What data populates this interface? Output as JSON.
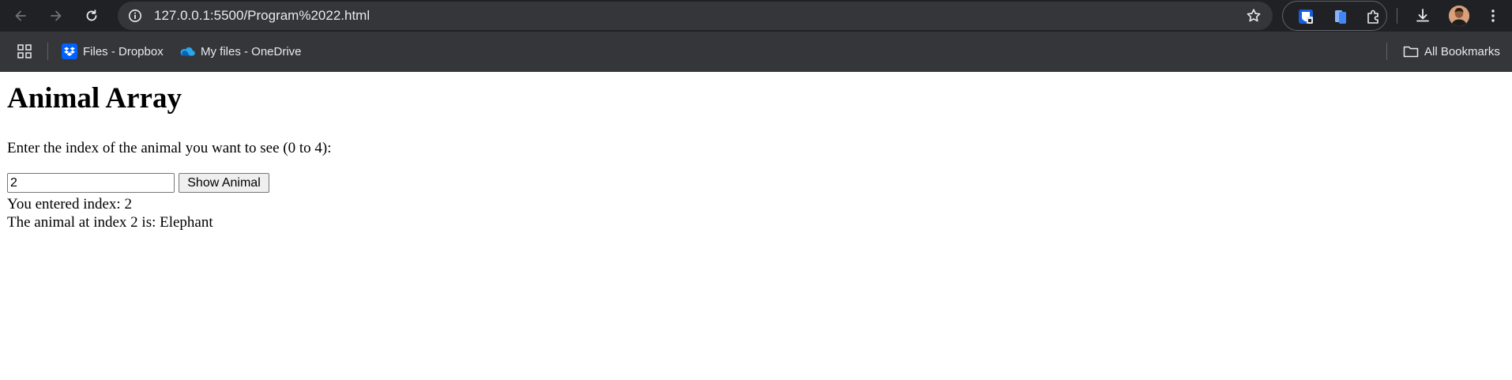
{
  "browser": {
    "url": "127.0.0.1:5500/Program%2022.html",
    "bookmarks": [
      {
        "label": "Files - Dropbox",
        "icon": "dropbox-icon"
      },
      {
        "label": "My files - OneDrive",
        "icon": "onedrive-icon"
      }
    ],
    "all_bookmarks_label": "All Bookmarks",
    "colors": {
      "toolbar_bg": "#202124",
      "omnibox_bg": "#35363a",
      "text": "#e8eaed",
      "dropbox_blue": "#0061fe",
      "onedrive_blue": "#28a8ea"
    }
  },
  "page": {
    "title": "Animal Array",
    "prompt": "Enter the index of the animal you want to see (0 to 4):",
    "input_value": "2",
    "button_label": "Show Animal",
    "result_entered": "You entered index: 2",
    "result_animal": "The animal at index 2 is: Elephant"
  }
}
